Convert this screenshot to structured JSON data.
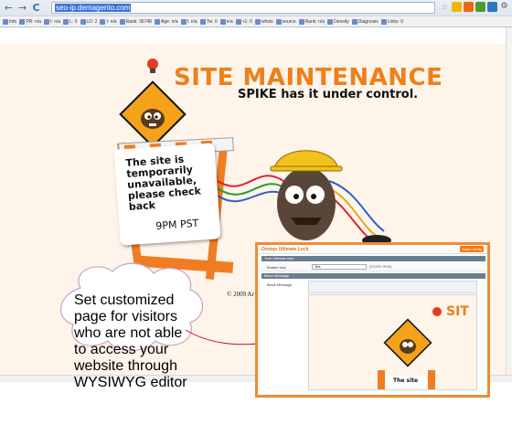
{
  "browser": {
    "url_prefix": "",
    "url_selected": "seo-ip.demagento.com",
    "nav_back": "←",
    "nav_forward": "→",
    "nav_reload": "C"
  },
  "seobar": {
    "items": [
      "Info",
      "PR: n/a",
      "I: n/a",
      "L: 0",
      "LD: 2",
      "I: n/a",
      "Rank: 36748",
      "Age: n/a",
      "I: n/a",
      "Tw: 0",
      "n/a",
      "+1: 0",
      "whois",
      "source",
      "Rank: n/a",
      "Density",
      "Diagnosis",
      "Links: 0"
    ]
  },
  "page": {
    "title": "SITE MAINTENANCE",
    "subtitle": "SPIKE has it under control.",
    "sign_text": "The site is temporarily unavailable, please check back",
    "sign_time": "9PM PST",
    "copyright": "© 2009 Ar"
  },
  "callout": {
    "text": "Set customized page for visitors who are not able to access your website through WYSIWYG editor"
  },
  "admin": {
    "title": "Onstep Ultimate Lock",
    "save_button": "Save Config",
    "section1": "Turn Ultimate lock",
    "enable_label": "Enable lock",
    "enable_value": "Yes",
    "enable_note": "[STORE VIEW]",
    "section2": "Block Message",
    "block_label": "Block Message",
    "editor_preview": "SIT",
    "editor_caption": "The site"
  },
  "colors": {
    "brand_orange": "#ef7f1a",
    "stage_bg": "#fff4ea",
    "callout_text": "#e57a1c",
    "arrow": "#c0121b"
  }
}
